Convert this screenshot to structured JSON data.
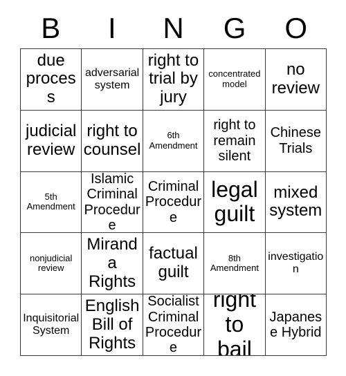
{
  "card": {
    "header_letters": [
      "B",
      "I",
      "N",
      "G",
      "O"
    ],
    "rows": [
      [
        {
          "text": "due process",
          "size": "l"
        },
        {
          "text": "adversarial system",
          "size": "s"
        },
        {
          "text": "right to trial by jury",
          "size": "l"
        },
        {
          "text": "concentrated model",
          "size": "xs"
        },
        {
          "text": "no review",
          "size": "l"
        }
      ],
      [
        {
          "text": "judicial review",
          "size": "l"
        },
        {
          "text": "right to counsel",
          "size": "l"
        },
        {
          "text": "6th Amendment",
          "size": "xs"
        },
        {
          "text": "right to remain silent",
          "size": "m"
        },
        {
          "text": "Chinese Trials",
          "size": "m"
        }
      ],
      [
        {
          "text": "5th Amendment",
          "size": "xs"
        },
        {
          "text": "Islamic Criminal Procedure",
          "size": "m"
        },
        {
          "text": "Criminal Procedure",
          "size": "m"
        },
        {
          "text": "legal guilt",
          "size": "xl"
        },
        {
          "text": "mixed system",
          "size": "l"
        }
      ],
      [
        {
          "text": "nonjudicial review",
          "size": "xs"
        },
        {
          "text": "Miranda Rights",
          "size": "l"
        },
        {
          "text": "factual guilt",
          "size": "l"
        },
        {
          "text": "8th Amendment",
          "size": "xs"
        },
        {
          "text": "investigation",
          "size": "s"
        }
      ],
      [
        {
          "text": "Inquisitorial System",
          "size": "s"
        },
        {
          "text": "English Bill of Rights",
          "size": "l"
        },
        {
          "text": "Socialist Criminal Procedure",
          "size": "m"
        },
        {
          "text": "right to bail",
          "size": "xl"
        },
        {
          "text": "Japanese Hybrid",
          "size": "m"
        }
      ]
    ]
  }
}
